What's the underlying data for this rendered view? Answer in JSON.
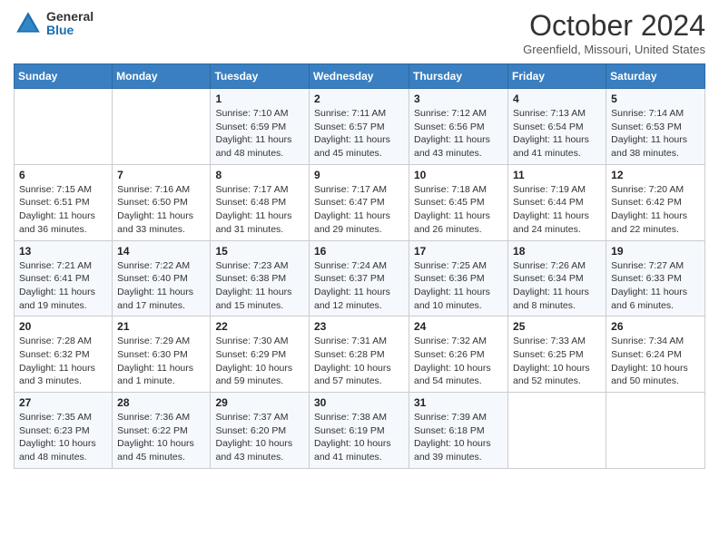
{
  "app": {
    "name": "GeneralBlue",
    "logo_label": "General Blue"
  },
  "header": {
    "month": "October 2024",
    "location": "Greenfield, Missouri, United States"
  },
  "weekdays": [
    "Sunday",
    "Monday",
    "Tuesday",
    "Wednesday",
    "Thursday",
    "Friday",
    "Saturday"
  ],
  "weeks": [
    [
      {
        "day": "",
        "info": ""
      },
      {
        "day": "",
        "info": ""
      },
      {
        "day": "1",
        "info": "Sunrise: 7:10 AM\nSunset: 6:59 PM\nDaylight: 11 hours and 48 minutes."
      },
      {
        "day": "2",
        "info": "Sunrise: 7:11 AM\nSunset: 6:57 PM\nDaylight: 11 hours and 45 minutes."
      },
      {
        "day": "3",
        "info": "Sunrise: 7:12 AM\nSunset: 6:56 PM\nDaylight: 11 hours and 43 minutes."
      },
      {
        "day": "4",
        "info": "Sunrise: 7:13 AM\nSunset: 6:54 PM\nDaylight: 11 hours and 41 minutes."
      },
      {
        "day": "5",
        "info": "Sunrise: 7:14 AM\nSunset: 6:53 PM\nDaylight: 11 hours and 38 minutes."
      }
    ],
    [
      {
        "day": "6",
        "info": "Sunrise: 7:15 AM\nSunset: 6:51 PM\nDaylight: 11 hours and 36 minutes."
      },
      {
        "day": "7",
        "info": "Sunrise: 7:16 AM\nSunset: 6:50 PM\nDaylight: 11 hours and 33 minutes."
      },
      {
        "day": "8",
        "info": "Sunrise: 7:17 AM\nSunset: 6:48 PM\nDaylight: 11 hours and 31 minutes."
      },
      {
        "day": "9",
        "info": "Sunrise: 7:17 AM\nSunset: 6:47 PM\nDaylight: 11 hours and 29 minutes."
      },
      {
        "day": "10",
        "info": "Sunrise: 7:18 AM\nSunset: 6:45 PM\nDaylight: 11 hours and 26 minutes."
      },
      {
        "day": "11",
        "info": "Sunrise: 7:19 AM\nSunset: 6:44 PM\nDaylight: 11 hours and 24 minutes."
      },
      {
        "day": "12",
        "info": "Sunrise: 7:20 AM\nSunset: 6:42 PM\nDaylight: 11 hours and 22 minutes."
      }
    ],
    [
      {
        "day": "13",
        "info": "Sunrise: 7:21 AM\nSunset: 6:41 PM\nDaylight: 11 hours and 19 minutes."
      },
      {
        "day": "14",
        "info": "Sunrise: 7:22 AM\nSunset: 6:40 PM\nDaylight: 11 hours and 17 minutes."
      },
      {
        "day": "15",
        "info": "Sunrise: 7:23 AM\nSunset: 6:38 PM\nDaylight: 11 hours and 15 minutes."
      },
      {
        "day": "16",
        "info": "Sunrise: 7:24 AM\nSunset: 6:37 PM\nDaylight: 11 hours and 12 minutes."
      },
      {
        "day": "17",
        "info": "Sunrise: 7:25 AM\nSunset: 6:36 PM\nDaylight: 11 hours and 10 minutes."
      },
      {
        "day": "18",
        "info": "Sunrise: 7:26 AM\nSunset: 6:34 PM\nDaylight: 11 hours and 8 minutes."
      },
      {
        "day": "19",
        "info": "Sunrise: 7:27 AM\nSunset: 6:33 PM\nDaylight: 11 hours and 6 minutes."
      }
    ],
    [
      {
        "day": "20",
        "info": "Sunrise: 7:28 AM\nSunset: 6:32 PM\nDaylight: 11 hours and 3 minutes."
      },
      {
        "day": "21",
        "info": "Sunrise: 7:29 AM\nSunset: 6:30 PM\nDaylight: 11 hours and 1 minute."
      },
      {
        "day": "22",
        "info": "Sunrise: 7:30 AM\nSunset: 6:29 PM\nDaylight: 10 hours and 59 minutes."
      },
      {
        "day": "23",
        "info": "Sunrise: 7:31 AM\nSunset: 6:28 PM\nDaylight: 10 hours and 57 minutes."
      },
      {
        "day": "24",
        "info": "Sunrise: 7:32 AM\nSunset: 6:26 PM\nDaylight: 10 hours and 54 minutes."
      },
      {
        "day": "25",
        "info": "Sunrise: 7:33 AM\nSunset: 6:25 PM\nDaylight: 10 hours and 52 minutes."
      },
      {
        "day": "26",
        "info": "Sunrise: 7:34 AM\nSunset: 6:24 PM\nDaylight: 10 hours and 50 minutes."
      }
    ],
    [
      {
        "day": "27",
        "info": "Sunrise: 7:35 AM\nSunset: 6:23 PM\nDaylight: 10 hours and 48 minutes."
      },
      {
        "day": "28",
        "info": "Sunrise: 7:36 AM\nSunset: 6:22 PM\nDaylight: 10 hours and 45 minutes."
      },
      {
        "day": "29",
        "info": "Sunrise: 7:37 AM\nSunset: 6:20 PM\nDaylight: 10 hours and 43 minutes."
      },
      {
        "day": "30",
        "info": "Sunrise: 7:38 AM\nSunset: 6:19 PM\nDaylight: 10 hours and 41 minutes."
      },
      {
        "day": "31",
        "info": "Sunrise: 7:39 AM\nSunset: 6:18 PM\nDaylight: 10 hours and 39 minutes."
      },
      {
        "day": "",
        "info": ""
      },
      {
        "day": "",
        "info": ""
      }
    ]
  ]
}
